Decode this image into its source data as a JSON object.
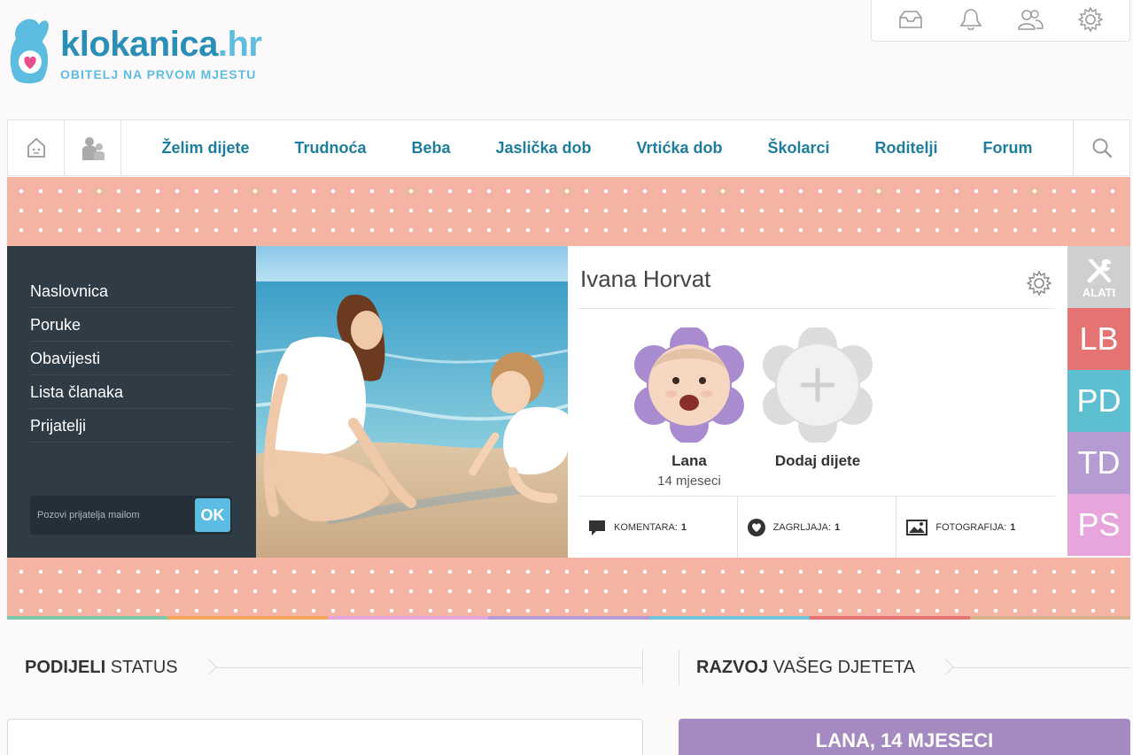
{
  "logo": {
    "name": "klokanica",
    "tld": ".hr",
    "tagline": "OBITELJ NA PRVOM MJESTU"
  },
  "top_icons": [
    "inbox-icon",
    "bell-icon",
    "friends-icon",
    "gear-icon"
  ],
  "nav": {
    "home_icon": "home-icon",
    "profile_icon": "family-icon",
    "links": [
      "Želim dijete",
      "Trudnoća",
      "Beba",
      "Jaslička dob",
      "Vrtićka dob",
      "Školarci",
      "Roditelji",
      "Forum"
    ],
    "search_icon": "search-icon"
  },
  "side_menu": {
    "items": [
      "Naslovnica",
      "Poruke",
      "Obavijesti",
      "Lista članaka",
      "Prijatelji"
    ],
    "invite_placeholder": "Pozovi prijatelja mailom",
    "invite_button": "OK"
  },
  "profile": {
    "name": "Ivana Horvat",
    "children": [
      {
        "name": "Lana",
        "age": "14 mjeseci"
      }
    ],
    "add_child": "Dodaj dijete",
    "stats": [
      {
        "label": "KOMENTARA:",
        "value": "1",
        "icon": "comment-icon"
      },
      {
        "label": "ZAGRLJAJA:",
        "value": "1",
        "icon": "heart-icon"
      },
      {
        "label": "FOTOGRAFIJA:",
        "value": "1",
        "icon": "photo-icon"
      }
    ]
  },
  "right_tabs": {
    "tools": "ALATI",
    "items": [
      {
        "label": "LB",
        "color": "#e57373"
      },
      {
        "label": "PD",
        "color": "#5dbfcf"
      },
      {
        "label": "TD",
        "color": "#b59bd1"
      },
      {
        "label": "PS",
        "color": "#e6a6dc"
      }
    ]
  },
  "colorbar": [
    "#7cc8a8",
    "#f3a55d",
    "#e6a6dc",
    "#b59bd1",
    "#6fc4d8",
    "#e57373",
    "#d9b08c"
  ],
  "sections": {
    "status_bold": "PODIJELI",
    "status_rest": " STATUS",
    "dev_bold": "RAZVOJ",
    "dev_rest": " VAŠEG DJETETA",
    "dev_box_title": "LANA, 14 MJESECI"
  }
}
